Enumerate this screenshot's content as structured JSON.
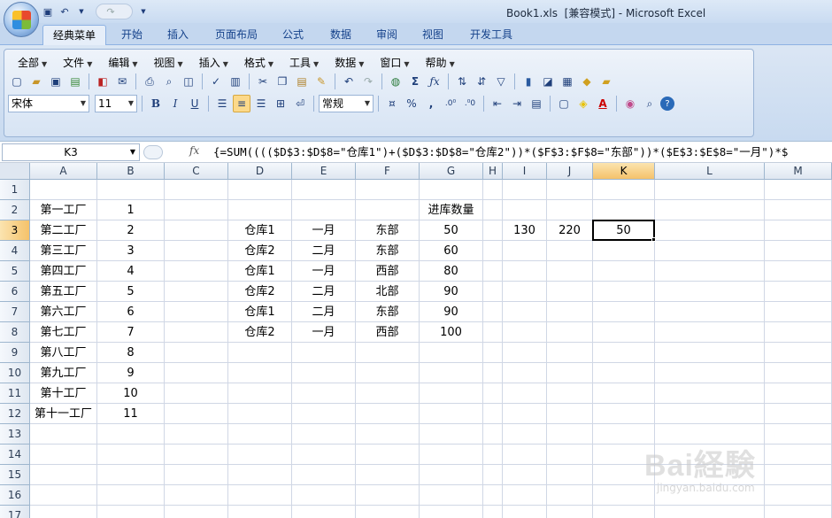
{
  "app": {
    "window_title": "Book1.xls  [兼容模式] - Microsoft Excel"
  },
  "ribbon_tabs": [
    "经典菜单",
    "开始",
    "插入",
    "页面布局",
    "公式",
    "数据",
    "审阅",
    "视图",
    "开发工具"
  ],
  "classic_menus": [
    "全部",
    "文件",
    "编辑",
    "视图",
    "插入",
    "格式",
    "工具",
    "数据",
    "窗口",
    "帮助"
  ],
  "format_bar": {
    "font_name": "宋体",
    "font_size": "11",
    "number_format": "常规",
    "bold": "B",
    "italic": "I",
    "underline": "U",
    "percent": "%",
    "comma": ","
  },
  "formula_bar": {
    "name_box": "K3",
    "fx": "fx",
    "formula": "{=SUM(((($D$3:$D$8=\"仓库1\")+($D$3:$D$8=\"仓库2\"))*($F$3:$F$8=\"东部\"))*($E$3:$E$8=\"一月\")*$"
  },
  "sheet": {
    "columns": [
      "A",
      "B",
      "C",
      "D",
      "E",
      "F",
      "G",
      "H",
      "I",
      "J",
      "K",
      "L",
      "M"
    ],
    "rows": [
      "1",
      "2",
      "3",
      "4",
      "5",
      "6",
      "7",
      "8",
      "9",
      "10",
      "11",
      "12",
      "13",
      "14",
      "15",
      "16",
      "17"
    ],
    "selected_cell": "K3",
    "cells": {
      "A2": "第一工厂",
      "B2": "1",
      "G2": "进库数量",
      "A3": "第二工厂",
      "B3": "2",
      "D3": "仓库1",
      "E3": "一月",
      "F3": "东部",
      "G3": "50",
      "I3": "130",
      "J3": "220",
      "K3": "50",
      "A4": "第三工厂",
      "B4": "3",
      "D4": "仓库2",
      "E4": "二月",
      "F4": "东部",
      "G4": "60",
      "A5": "第四工厂",
      "B5": "4",
      "D5": "仓库1",
      "E5": "一月",
      "F5": "西部",
      "G5": "80",
      "A6": "第五工厂",
      "B6": "5",
      "D6": "仓库2",
      "E6": "二月",
      "F6": "北部",
      "G6": "90",
      "A7": "第六工厂",
      "B7": "6",
      "D7": "仓库1",
      "E7": "二月",
      "F7": "东部",
      "G7": "90",
      "A8": "第七工厂",
      "B8": "7",
      "D8": "仓库2",
      "E8": "一月",
      "F8": "西部",
      "G8": "100",
      "A9": "第八工厂",
      "B9": "8",
      "A10": "第九工厂",
      "B10": "9",
      "A11": "第十工厂",
      "B11": "10",
      "A12": "第十一工厂",
      "B12": "11"
    }
  },
  "watermark": {
    "brand": "Bai経験",
    "url": "jingyan.baidu.com"
  }
}
